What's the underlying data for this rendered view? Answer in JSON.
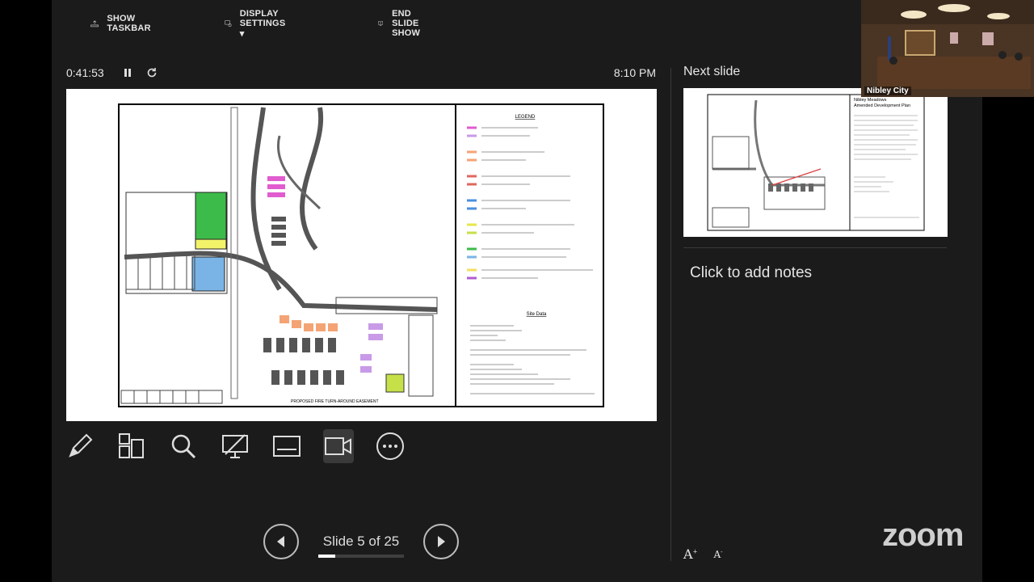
{
  "toolbar": {
    "show_taskbar": "SHOW TASKBAR",
    "display_settings": "DISPLAY SETTINGS ▾",
    "end_slide_show": "END SLIDE SHOW"
  },
  "presenter": {
    "elapsed": "0:41:53",
    "clock": "8:10 PM",
    "next_slide_label": "Next slide",
    "notes_placeholder": "Click to add notes",
    "slide_counter": "Slide 5 of 25",
    "progress_fraction": 0.2
  },
  "slide": {
    "legend_title": "LEGEND",
    "site_data_title": "Site Data",
    "easement_label": "PROPOSED FIRE TURN-AROUND EASEMENT"
  },
  "next_slide": {
    "title_line1": "Nibley Meadows",
    "title_line2": "Amended Development Plan"
  },
  "video": {
    "participant_name": "Nibley City"
  },
  "branding": {
    "logo_text": "zoom"
  },
  "font_controls": {
    "increase": "A",
    "decrease": "A"
  },
  "icons": {
    "pen": "pen-icon",
    "grid": "see-all-slides-icon",
    "zoom": "magnifier-icon",
    "laser": "laser-pointer-icon",
    "subtitles": "subtitles-icon",
    "camera": "camera-icon",
    "more": "more-options-icon"
  }
}
